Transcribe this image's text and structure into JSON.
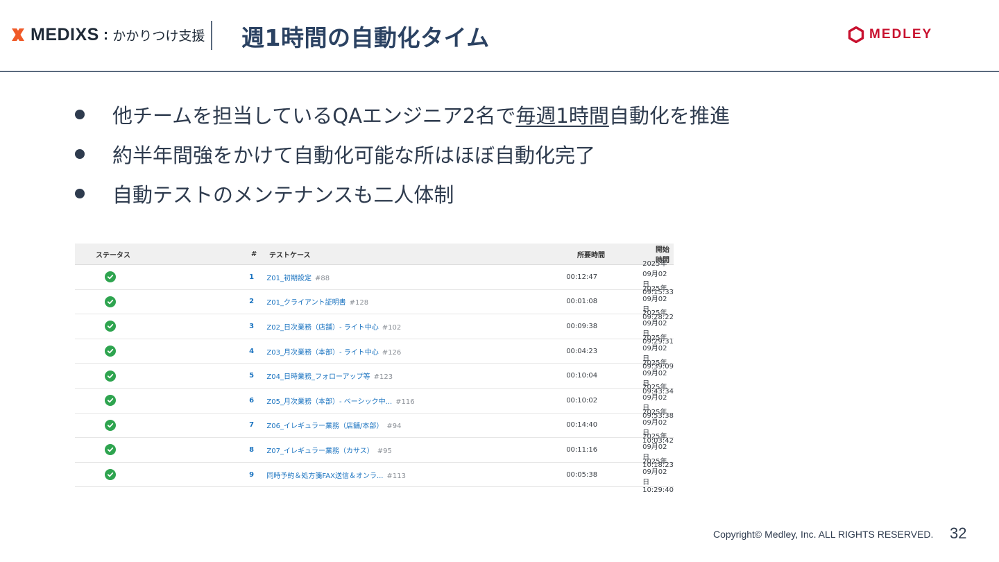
{
  "header": {
    "brand_name": "MEDIXS",
    "brand_colon": ":",
    "brand_sub": "かかりつけ支援",
    "title": "週1時間の自動化タイム",
    "company": "MEDLEY"
  },
  "bullets": [
    {
      "pre": "他チームを担当しているQAエンジニア2名で",
      "underlined": "毎週1時間",
      "post": "自動化を推進"
    },
    {
      "pre": "約半年間強をかけて自動化可能な所はほぼ自動化完了",
      "underlined": "",
      "post": ""
    },
    {
      "pre": "自動テストのメンテナンスも二人体制",
      "underlined": "",
      "post": ""
    }
  ],
  "table": {
    "headers": {
      "status": "ステータス",
      "num": "#",
      "case": "テストケース",
      "duration": "所要時間",
      "start": "開始時間"
    },
    "status_color": "#2ea44f",
    "link_color": "#1a73c0",
    "rows": [
      {
        "num": "1",
        "name": "Z01_初期設定",
        "id": "#88",
        "duration": "00:12:47",
        "start": "2025年09月02日 09:15:33"
      },
      {
        "num": "2",
        "name": "Z01_クライアント証明書",
        "id": "#128",
        "duration": "00:01:08",
        "start": "2025年09月02日 09:28:22"
      },
      {
        "num": "3",
        "name": "Z02_日次業務（店舗）- ライト中心",
        "id": "#102",
        "duration": "00:09:38",
        "start": "2025年09月02日 09:29:31"
      },
      {
        "num": "4",
        "name": "Z03_月次業務（本部）- ライト中心",
        "id": "#126",
        "duration": "00:04:23",
        "start": "2025年09月02日 09:39:09"
      },
      {
        "num": "5",
        "name": "Z04_日時業務_フォローアップ等",
        "id": "#123",
        "duration": "00:10:04",
        "start": "2025年09月02日 09:43:34"
      },
      {
        "num": "6",
        "name": "Z05_月次業務（本部）- ベーシック中...",
        "id": "#116",
        "duration": "00:10:02",
        "start": "2025年09月02日 09:53:38"
      },
      {
        "num": "7",
        "name": "Z06_イレギュラー業務（店舗/本部）",
        "id": "#94",
        "duration": "00:14:40",
        "start": "2025年09月02日 10:03:42"
      },
      {
        "num": "8",
        "name": "Z07_イレギュラー業務（カサス）",
        "id": "#95",
        "duration": "00:11:16",
        "start": "2025年09月02日 10:18:23"
      },
      {
        "num": "9",
        "name": "同時予約＆処方箋FAX送信＆オンラ...",
        "id": "#113",
        "duration": "00:05:38",
        "start": "2025年09月02日 10:29:40"
      }
    ]
  },
  "footer": {
    "copyright": "Copyright© Medley, Inc. ALL RIGHTS RESERVED.",
    "page_number": "32"
  }
}
